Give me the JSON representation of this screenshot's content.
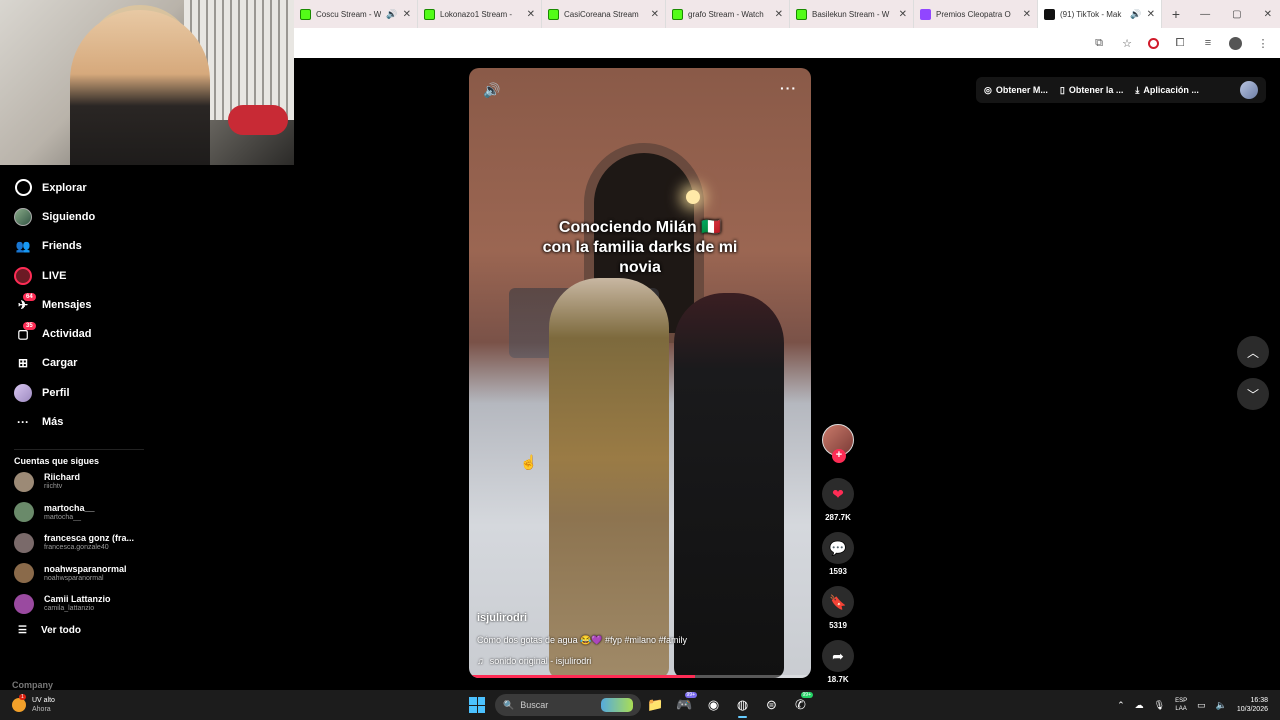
{
  "browser": {
    "tabs": [
      {
        "title": "Coscu Stream - W",
        "favicon": "kick",
        "sound": true
      },
      {
        "title": "Lokonazo1 Stream -",
        "favicon": "kick"
      },
      {
        "title": "CasiCoreana Stream",
        "favicon": "kick"
      },
      {
        "title": "grafo Stream - Watch",
        "favicon": "kick"
      },
      {
        "title": "Basilekun Stream - W",
        "favicon": "kick"
      },
      {
        "title": "Premios Cleopatra O",
        "favicon": "twitch"
      },
      {
        "title": "(91) TikTok - Mak",
        "favicon": "tiktok",
        "sound": true,
        "active": true
      }
    ],
    "new_tab": "+",
    "close_glyph": "✕",
    "toolbar_icons": [
      "install-icon",
      "star-icon",
      "opera-icon",
      "extensions-icon",
      "media-icon",
      "profile-icon",
      "menu-icon"
    ]
  },
  "sidebar": {
    "items": [
      {
        "label": "Explorar",
        "icon": "compass-icon"
      },
      {
        "label": "Siguiendo",
        "icon": "avatar-icon"
      },
      {
        "label": "Friends",
        "icon": "friends-icon"
      },
      {
        "label": "LIVE",
        "icon": "live-icon"
      },
      {
        "label": "Mensajes",
        "icon": "messages-icon",
        "badge": "64"
      },
      {
        "label": "Actividad",
        "icon": "activity-icon",
        "badge": "35"
      },
      {
        "label": "Cargar",
        "icon": "upload-icon"
      },
      {
        "label": "Perfil",
        "icon": "profile-icon"
      },
      {
        "label": "Más",
        "icon": "more-icon"
      }
    ],
    "following_title": "Cuentas que sigues",
    "accounts": [
      {
        "name": "Riichard",
        "user": "riichtv",
        "color": "#9c8a76"
      },
      {
        "name": "martocha__",
        "user": "martocha__",
        "color": "#6a8a6a"
      },
      {
        "name": "francesca gonz (fra...",
        "user": "francesca.gonzale40",
        "color": "#7a6a6a"
      },
      {
        "name": "noahwsparanormal",
        "user": "noahwsparanormal",
        "color": "#8a6a4a"
      },
      {
        "name": "Camii Lattanzio",
        "user": "camila_lattanzio",
        "color": "#9a4aa0"
      }
    ],
    "see_all": "Ver todo",
    "company": "Company"
  },
  "video": {
    "overlay_text": "Conociendo Milán 🇮🇹\ncon la familia darks de mi\nnovia",
    "author": "isjulirodri",
    "description": "Cómo dos gotas de agua 😂💜 #fyp #milano #family",
    "sound": "sonido original - isjulirodri",
    "progress": 0.66
  },
  "actions": {
    "likes": "287.7K",
    "comments": "1593",
    "saves": "5319",
    "shares": "18.7K"
  },
  "topright": {
    "items": [
      "Obtener M...",
      "Obtener la ...",
      "Aplicación ..."
    ]
  },
  "taskbar": {
    "weather_title": "UV alto",
    "weather_sub": "Ahora",
    "weather_badge": "1",
    "search_placeholder": "Buscar",
    "lang_top": "ESP",
    "lang_bottom": "LAA",
    "time": "16:38",
    "date": "10/3/2026",
    "discord_badge": "99+",
    "whatsapp_badge": "99+"
  }
}
